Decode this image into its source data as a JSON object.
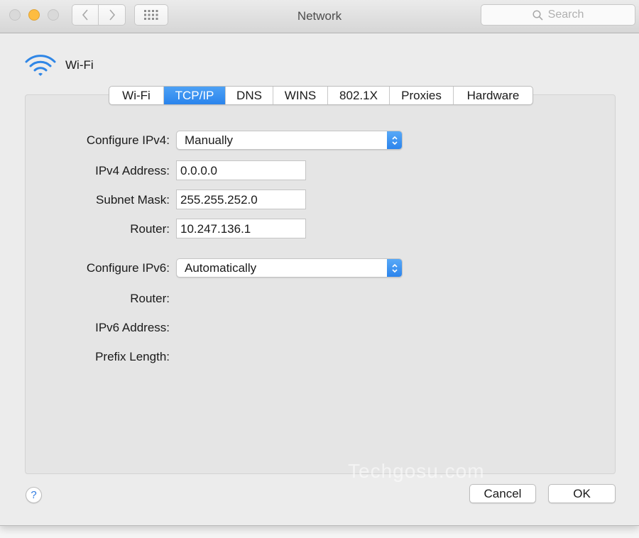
{
  "window": {
    "title": "Network",
    "search_placeholder": "Search"
  },
  "header": {
    "service_name": "Wi-Fi",
    "service_icon": "wifi-icon"
  },
  "tabs": [
    {
      "label": "Wi-Fi",
      "active": false
    },
    {
      "label": "TCP/IP",
      "active": true
    },
    {
      "label": "DNS",
      "active": false
    },
    {
      "label": "WINS",
      "active": false
    },
    {
      "label": "802.1X",
      "active": false
    },
    {
      "label": "Proxies",
      "active": false
    },
    {
      "label": "Hardware",
      "active": false
    }
  ],
  "ipv4": {
    "configure_label": "Configure IPv4:",
    "configure_value": "Manually",
    "address_label": "IPv4 Address:",
    "address_value": "0.0.0.0",
    "subnet_label": "Subnet Mask:",
    "subnet_value": "255.255.252.0",
    "router_label": "Router:",
    "router_value": "10.247.136.1"
  },
  "ipv6": {
    "configure_label": "Configure IPv6:",
    "configure_value": "Automatically",
    "router_label": "Router:",
    "address_label": "IPv6 Address:",
    "prefix_label": "Prefix Length:"
  },
  "buttons": {
    "help": "?",
    "cancel": "Cancel",
    "ok": "OK"
  },
  "watermark": "Techgosu.com",
  "colors": {
    "accent": "#2a84ec",
    "minimize": "#fdbc40"
  }
}
